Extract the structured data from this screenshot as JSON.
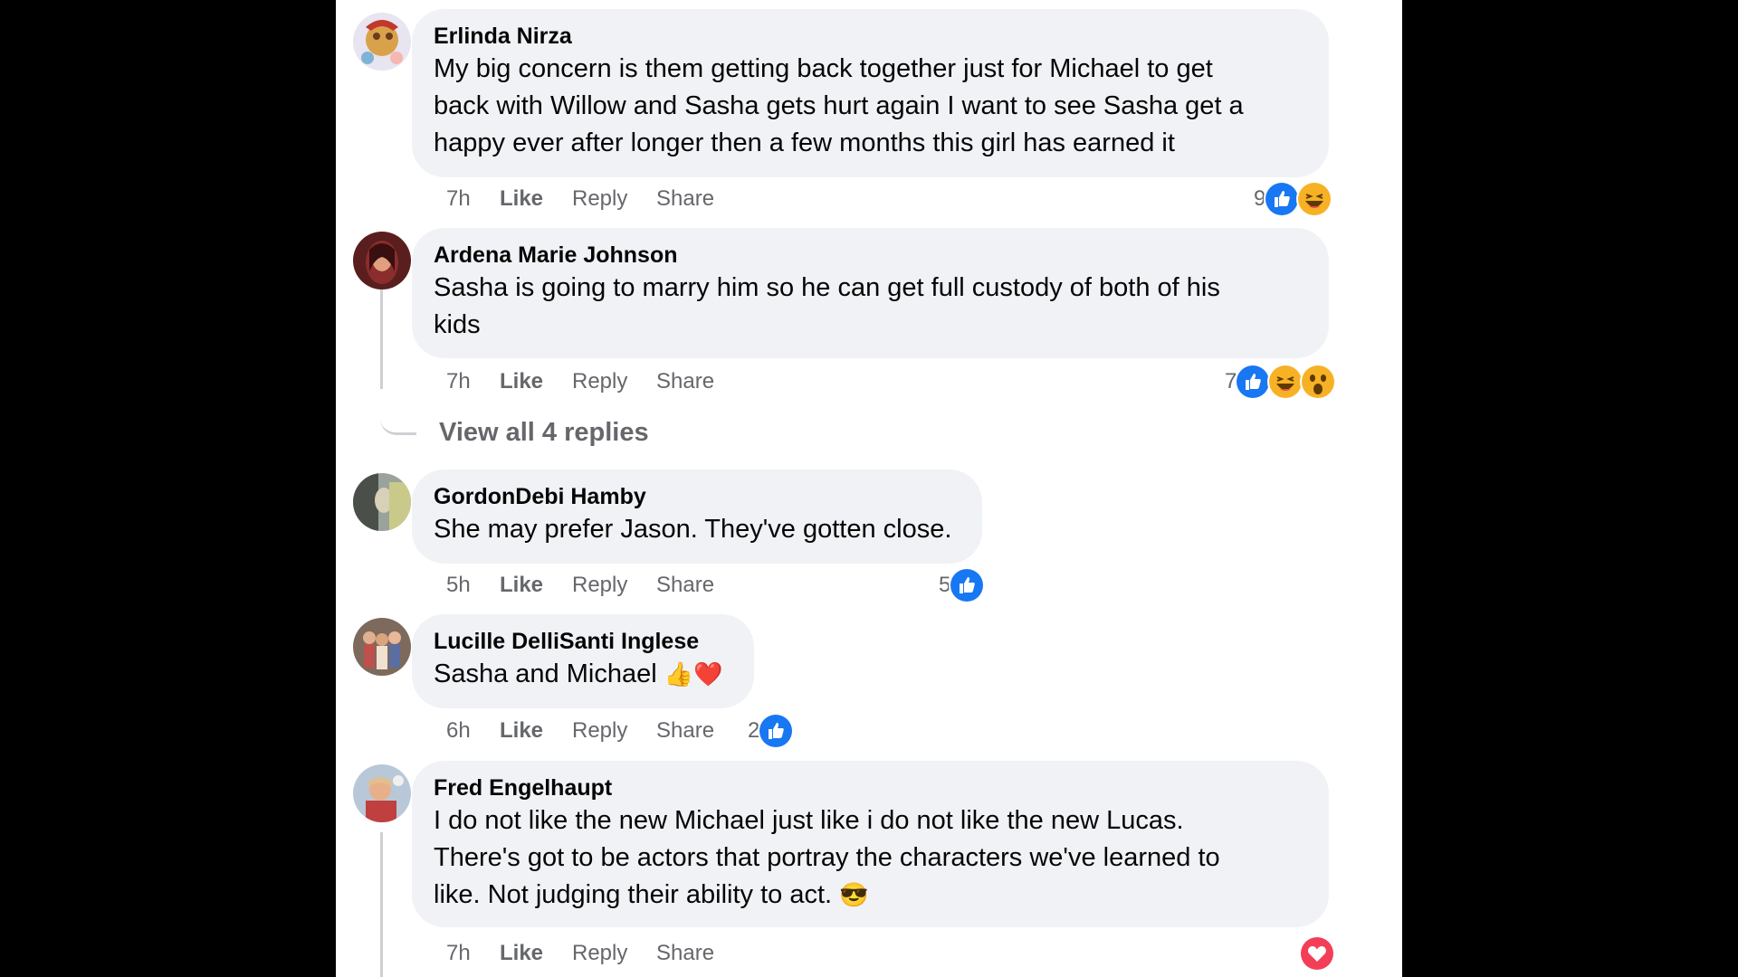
{
  "comments": [
    {
      "author": "Erlinda Nirza",
      "lines": [
        "My big concern is them getting back together just for Michael to get",
        "back with Willow and Sasha gets hurt again I want to see Sasha get a",
        "happy ever after longer then a few months this girl has earned it"
      ],
      "time": "7h",
      "like": "Like",
      "reply": "Reply",
      "share": "Share",
      "reaction_count": "9",
      "reactions": [
        "like-icon",
        "haha-icon"
      ]
    },
    {
      "author": "Ardena Marie Johnson",
      "lines": [
        "Sasha is going to marry him so he can get full custody of both of his",
        "kids"
      ],
      "time": "7h",
      "like": "Like",
      "reply": "Reply",
      "share": "Share",
      "reaction_count": "7",
      "reactions": [
        "like-icon",
        "haha-icon",
        "wow-icon"
      ],
      "view_replies": "View all 4 replies"
    },
    {
      "author": "GordonDebi Hamby",
      "lines": [
        "She may prefer Jason. They've gotten close."
      ],
      "time": "5h",
      "like": "Like",
      "reply": "Reply",
      "share": "Share",
      "reaction_count": "5",
      "reactions": [
        "like-icon"
      ]
    },
    {
      "author": "Lucille DelliSanti Inglese",
      "lines": [
        "Sasha and Michael"
      ],
      "emoji": "👍❤️",
      "time": "6h",
      "like": "Like",
      "reply": "Reply",
      "share": "Share",
      "reaction_count": "2",
      "reactions": [
        "like-icon"
      ]
    },
    {
      "author": "Fred Engelhaupt",
      "lines": [
        "I do not like the new Michael just like i do not like the new Lucas.",
        "There's got to be actors that portray the characters we've learned to",
        "like. Not judging their ability to act."
      ],
      "emoji": "😎",
      "time": "7h",
      "like": "Like",
      "reply": "Reply",
      "share": "Share",
      "reaction_count": "",
      "reactions": [
        "love-icon"
      ]
    }
  ],
  "colors": {
    "bubble": "#f0f2f5",
    "secondary_text": "#65676b",
    "like_blue": "#1877f2",
    "love_red": "#f33e58",
    "haha_yellow": "#f7b125"
  }
}
